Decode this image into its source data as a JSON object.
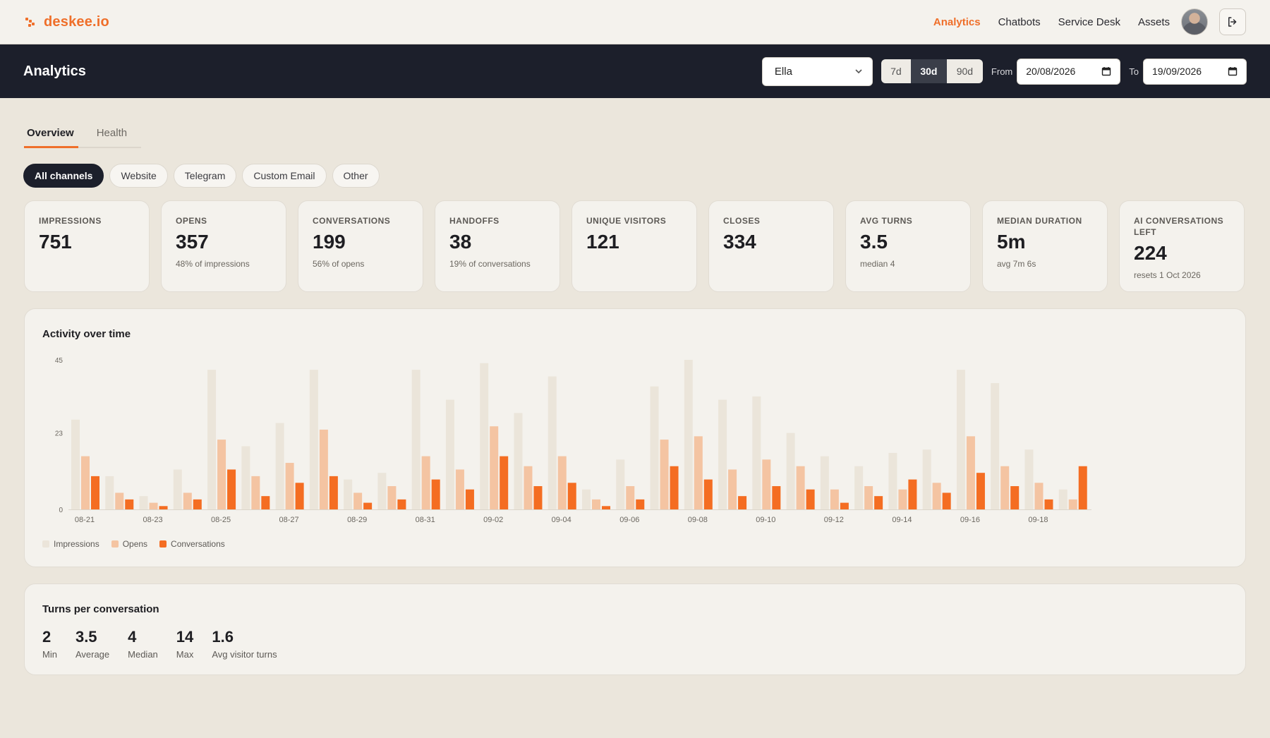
{
  "app": {
    "brand": "deskee.io",
    "nav": [
      {
        "label": "Analytics",
        "active": true
      },
      {
        "label": "Chatbots",
        "active": false
      },
      {
        "label": "Service Desk",
        "active": false
      },
      {
        "label": "Assets",
        "active": false
      }
    ],
    "accent_color": "#ef6f2a",
    "header_bg": "#1c1f2b"
  },
  "header": {
    "title": "Analytics",
    "bot_select": "Ella",
    "ranges": [
      "7d",
      "30d",
      "90d"
    ],
    "active_range": "30d",
    "from_label": "From",
    "from_date": "20/08/2026",
    "to_label": "To",
    "to_date": "19/09/2026"
  },
  "tabs": [
    {
      "label": "Overview",
      "active": true
    },
    {
      "label": "Health",
      "active": false
    }
  ],
  "channels": [
    {
      "label": "All channels",
      "active": true
    },
    {
      "label": "Website",
      "active": false
    },
    {
      "label": "Telegram",
      "active": false
    },
    {
      "label": "Custom Email",
      "active": false
    },
    {
      "label": "Other",
      "active": false
    }
  ],
  "stats": [
    {
      "title": "Impressions",
      "value": "751",
      "sub": ""
    },
    {
      "title": "Opens",
      "value": "357",
      "sub": "48% of impressions"
    },
    {
      "title": "Conversations",
      "value": "199",
      "sub": "56% of opens"
    },
    {
      "title": "Handoffs",
      "value": "38",
      "sub": "19% of conversations"
    },
    {
      "title": "Unique visitors",
      "value": "121",
      "sub": ""
    },
    {
      "title": "Closes",
      "value": "334",
      "sub": ""
    },
    {
      "title": "Avg turns",
      "value": "3.5",
      "sub": "median 4"
    },
    {
      "title": "Median duration",
      "value": "5m",
      "sub": "avg 7m 6s"
    },
    {
      "title": "AI conversations left",
      "value": "224",
      "sub": "resets 1 Oct 2026"
    }
  ],
  "activity": {
    "title": "Activity over time"
  },
  "chart_data": {
    "type": "bar",
    "title": "Activity over time",
    "ylim": [
      0,
      45
    ],
    "yticks": [
      0,
      23,
      45
    ],
    "grid": false,
    "legend": "bottom-left",
    "categories": [
      "08-21",
      "08-22",
      "08-23",
      "08-24",
      "08-25",
      "08-26",
      "08-27",
      "08-28",
      "08-29",
      "08-30",
      "08-31",
      "09-01",
      "09-02",
      "09-03",
      "09-04",
      "09-05",
      "09-06",
      "09-07",
      "09-08",
      "09-09",
      "09-10",
      "09-11",
      "09-12",
      "09-13",
      "09-14",
      "09-15",
      "09-16",
      "09-17",
      "09-18",
      "09-19"
    ],
    "tick_labels": [
      "08-21",
      "08-23",
      "08-25",
      "08-27",
      "08-29",
      "08-31",
      "09-02",
      "09-04",
      "09-06",
      "09-08",
      "09-10",
      "09-12",
      "09-14",
      "09-16",
      "09-18"
    ],
    "series": [
      {
        "name": "Impressions",
        "color": "#ebe5da",
        "values": [
          27,
          10,
          4,
          12,
          42,
          19,
          26,
          42,
          9,
          11,
          42,
          33,
          44,
          29,
          40,
          6,
          15,
          37,
          45,
          33,
          34,
          23,
          16,
          13,
          17,
          18,
          42,
          38,
          18,
          6
        ]
      },
      {
        "name": "Opens",
        "color": "#f4c4a2",
        "values": [
          16,
          5,
          2,
          5,
          21,
          10,
          14,
          24,
          5,
          7,
          16,
          12,
          25,
          13,
          16,
          3,
          7,
          21,
          22,
          12,
          15,
          13,
          6,
          7,
          6,
          8,
          22,
          13,
          8,
          3
        ]
      },
      {
        "name": "Conversations",
        "color": "#f46d22",
        "values": [
          10,
          3,
          1,
          3,
          12,
          4,
          8,
          10,
          2,
          3,
          9,
          6,
          16,
          7,
          8,
          1,
          3,
          13,
          9,
          4,
          7,
          6,
          2,
          4,
          9,
          5,
          11,
          7,
          3,
          13
        ]
      }
    ]
  },
  "turns": {
    "title": "Turns per conversation",
    "metrics": [
      {
        "value": "2",
        "label": "Min"
      },
      {
        "value": "3.5",
        "label": "Average"
      },
      {
        "value": "4",
        "label": "Median"
      },
      {
        "value": "14",
        "label": "Max"
      },
      {
        "value": "1.6",
        "label": "Avg visitor turns"
      }
    ]
  }
}
